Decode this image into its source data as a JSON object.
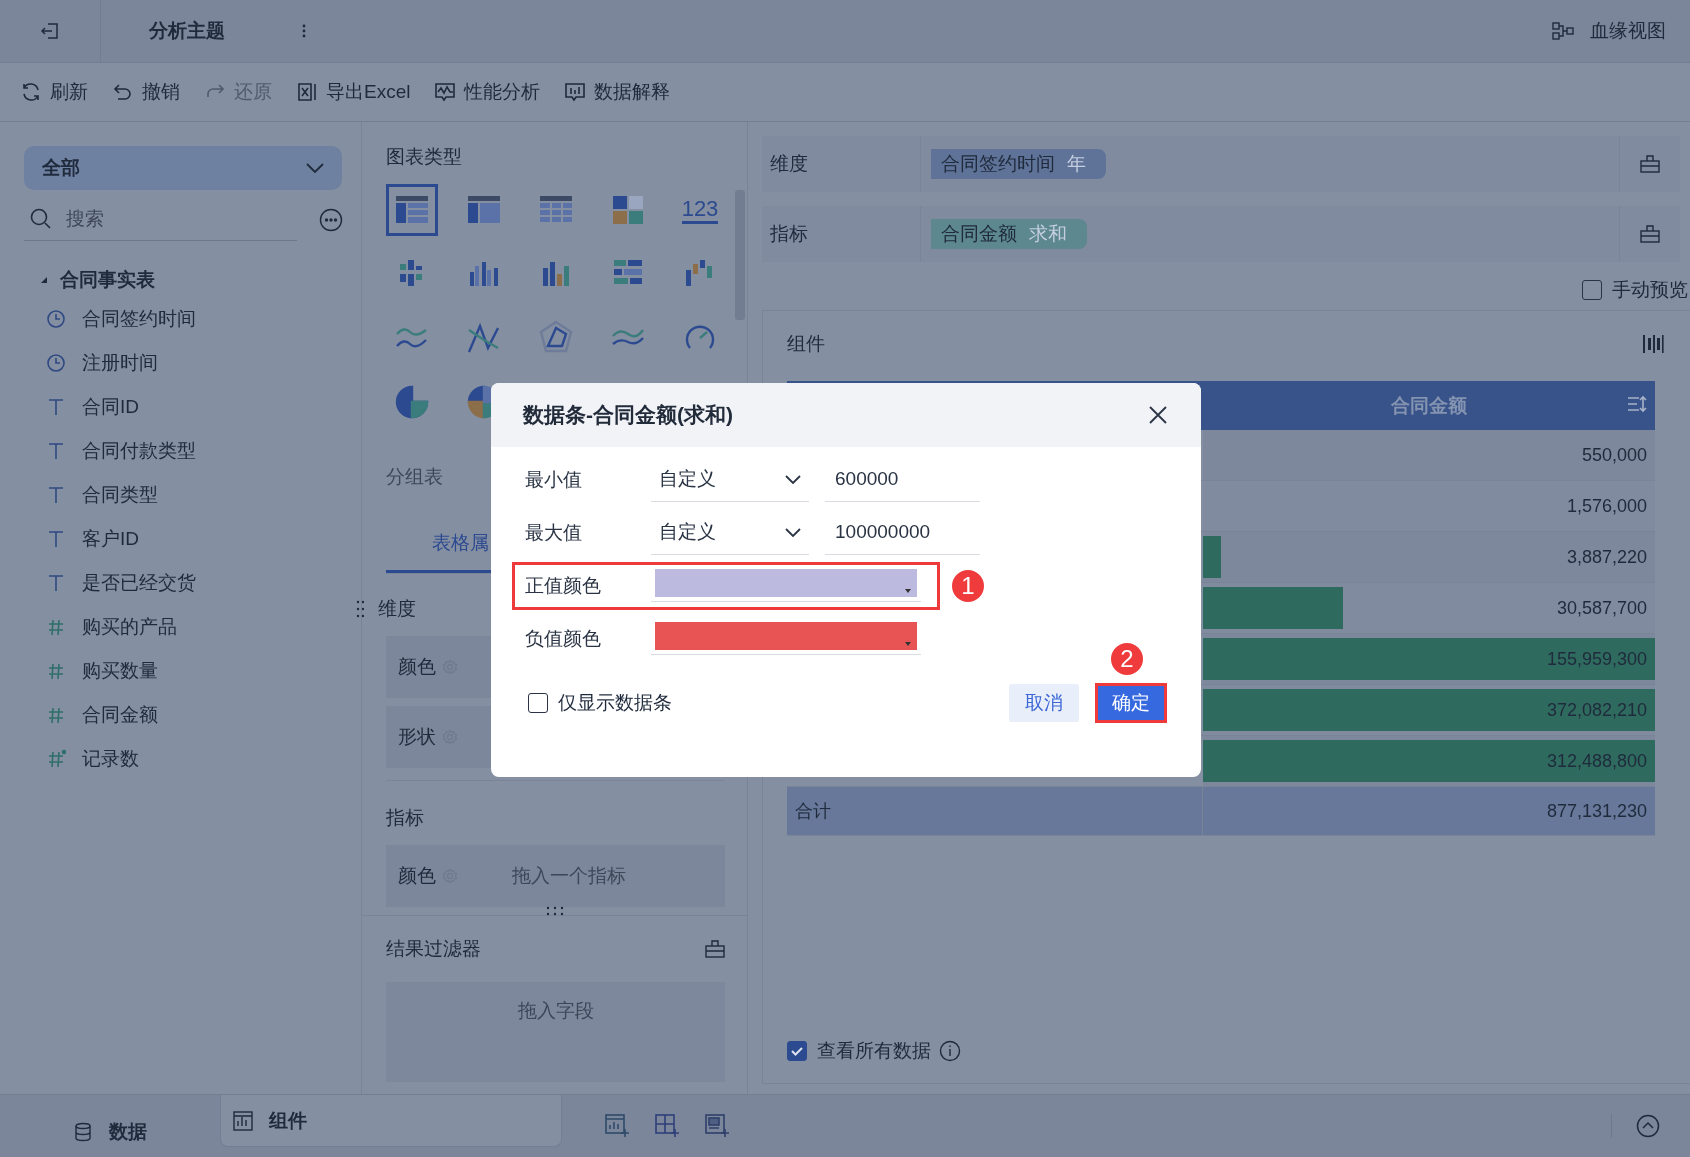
{
  "header": {
    "title": "分析主题",
    "lineage_label": "血缘视图"
  },
  "toolbar": [
    {
      "label": "刷新",
      "kind": "refresh",
      "disabled": false
    },
    {
      "label": "撤销",
      "kind": "undo",
      "disabled": false
    },
    {
      "label": "还原",
      "kind": "redo",
      "disabled": true
    },
    {
      "label": "导出Excel",
      "kind": "excel",
      "disabled": false
    },
    {
      "label": "性能分析",
      "kind": "perf",
      "disabled": false
    },
    {
      "label": "数据解释",
      "kind": "explain",
      "disabled": false
    }
  ],
  "data_panel": {
    "scope": "全部",
    "search": {
      "placeholder": "搜索"
    },
    "tree": [
      {
        "label": "合同事实表",
        "expanded": true,
        "children": [
          {
            "label": "合同签约时间",
            "kind": "time"
          },
          {
            "label": "注册时间",
            "kind": "time"
          },
          {
            "label": "合同ID",
            "kind": "text"
          },
          {
            "label": "合同付款类型",
            "kind": "text"
          },
          {
            "label": "合同类型",
            "kind": "text"
          },
          {
            "label": "客户ID",
            "kind": "text"
          },
          {
            "label": "是否已经交货",
            "kind": "text"
          },
          {
            "label": "购买的产品",
            "kind": "number"
          },
          {
            "label": "购买数量",
            "kind": "number"
          },
          {
            "label": "合同金额",
            "kind": "number"
          },
          {
            "label": "记录数",
            "kind": "count"
          }
        ]
      }
    ]
  },
  "chart_panel": {
    "title": "图表类型",
    "chart_types": [
      {
        "kind": "table",
        "selected": true
      },
      {
        "kind": "crosstable",
        "selected": false
      },
      {
        "kind": "detail",
        "selected": false
      },
      {
        "kind": "blocks",
        "selected": false
      },
      {
        "kind": "number",
        "label": "123",
        "selected": false
      },
      {
        "kind": "stacked",
        "selected": false
      },
      {
        "kind": "grouped",
        "selected": false
      },
      {
        "kind": "bars",
        "selected": false
      },
      {
        "kind": "hbars",
        "selected": false
      },
      {
        "kind": "range",
        "selected": false
      },
      {
        "kind": "line",
        "selected": false
      },
      {
        "kind": "cross",
        "selected": false
      },
      {
        "kind": "radar",
        "selected": false
      },
      {
        "kind": "area",
        "selected": false
      },
      {
        "kind": "gauge",
        "selected": false
      },
      {
        "kind": "pie",
        "selected": false
      },
      {
        "kind": "pies",
        "selected": false
      }
    ],
    "chart_name": "分组表",
    "tabs": [
      {
        "label": "表格属",
        "selected": true
      }
    ],
    "dimension": {
      "title": "维度",
      "slots": [
        {
          "label": "颜色"
        },
        {
          "label": "形状"
        }
      ]
    },
    "measure": {
      "title": "指标",
      "slots": [
        {
          "label": "颜色",
          "placeholder": "拖入一个指标"
        }
      ]
    },
    "filter": {
      "title": "结果过滤器",
      "placeholder": "拖入字段"
    }
  },
  "query": {
    "rows": [
      {
        "label": "维度",
        "kind": "dimension",
        "chip": "合同签约时间",
        "suffix": "年"
      },
      {
        "label": "指标",
        "kind": "measure",
        "chip": "合同金额",
        "suffix": "求和"
      }
    ],
    "manual_preview": {
      "label": "手动预览",
      "checked": false
    }
  },
  "component": {
    "title": "组件",
    "table": {
      "column": "合同金额",
      "rows": [
        {
          "value": "550,000"
        },
        {
          "value": "1,576,000"
        },
        {
          "value": "3,887,220",
          "level": 0.04
        },
        {
          "value": "30,587,700",
          "level": 0.31
        },
        {
          "value": "155,959,300",
          "level": 1
        },
        {
          "value": "372,082,210",
          "level": 1
        },
        {
          "value": "312,488,800",
          "level": 1
        }
      ],
      "total": {
        "label": "合计",
        "value": "877,131,230"
      }
    },
    "show_all": {
      "label": "查看所有数据",
      "checked": true
    }
  },
  "bottom_tabs": [
    {
      "label": "数据",
      "kind": "data",
      "selected": false
    },
    {
      "label": "组件",
      "kind": "component",
      "selected": true
    }
  ],
  "dialog": {
    "title": "数据条-合同金额(求和)",
    "rows": [
      {
        "label": "最小值",
        "kind": "range",
        "mode": "自定义",
        "value": "600000",
        "highlighted": false
      },
      {
        "label": "最大值",
        "kind": "range",
        "mode": "自定义",
        "value": "100000000",
        "highlighted": false
      },
      {
        "label": "正值颜色",
        "kind": "color",
        "color": "#bcbbdf",
        "highlighted": true,
        "badge": "1"
      },
      {
        "label": "负值颜色",
        "kind": "color",
        "color": "#e85454",
        "highlighted": false
      }
    ],
    "bars_only": {
      "label": "仅显示数据条",
      "checked": false
    },
    "cancel": "取消",
    "confirm": {
      "label": "确定",
      "highlighted": true,
      "badge": "2"
    }
  }
}
